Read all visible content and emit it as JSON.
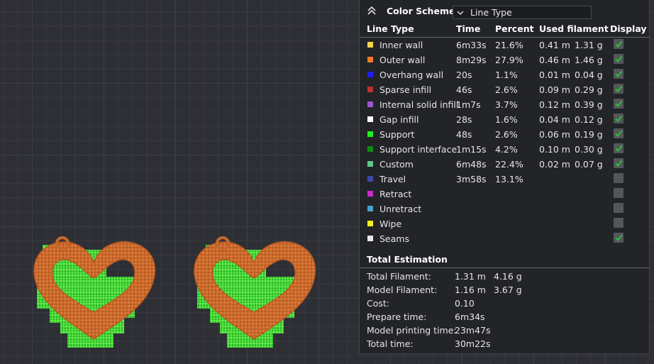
{
  "panel": {
    "title": "Color Scheme",
    "scheme_select": "Line Type",
    "headers": {
      "line_type": "Line Type",
      "time": "Time",
      "percent": "Percent",
      "used_filament": "Used filament",
      "display": "Display"
    },
    "rows": [
      {
        "name": "Inner wall",
        "color": "#f5d54b",
        "time": "6m33s",
        "percent": "21.6%",
        "meters": "0.41 m",
        "grams": "1.31 g",
        "display": true
      },
      {
        "name": "Outer wall",
        "color": "#f07a2c",
        "time": "8m29s",
        "percent": "27.9%",
        "meters": "0.46 m",
        "grams": "1.46 g",
        "display": true
      },
      {
        "name": "Overhang wall",
        "color": "#1f1ff0",
        "time": "20s",
        "percent": "1.1%",
        "meters": "0.01 m",
        "grams": "0.04 g",
        "display": true
      },
      {
        "name": "Sparse infill",
        "color": "#b83333",
        "time": "46s",
        "percent": "2.6%",
        "meters": "0.09 m",
        "grams": "0.29 g",
        "display": true
      },
      {
        "name": "Internal solid infill",
        "color": "#9a5ad0",
        "time": "1m7s",
        "percent": "3.7%",
        "meters": "0.12 m",
        "grams": "0.39 g",
        "display": true
      },
      {
        "name": "Gap infill",
        "color": "#ffffff",
        "time": "28s",
        "percent": "1.6%",
        "meters": "0.04 m",
        "grams": "0.12 g",
        "display": true
      },
      {
        "name": "Support",
        "color": "#22ee22",
        "time": "48s",
        "percent": "2.6%",
        "meters": "0.06 m",
        "grams": "0.19 g",
        "display": true
      },
      {
        "name": "Support interface",
        "color": "#128a12",
        "time": "1m15s",
        "percent": "4.2%",
        "meters": "0.10 m",
        "grams": "0.30 g",
        "display": true
      },
      {
        "name": "Custom",
        "color": "#5ec88e",
        "time": "6m48s",
        "percent": "22.4%",
        "meters": "0.02 m",
        "grams": "0.07 g",
        "display": true
      },
      {
        "name": "Travel",
        "color": "#3c4aa6",
        "time": "3m58s",
        "percent": "13.1%",
        "meters": "",
        "grams": "",
        "display": false
      },
      {
        "name": "Retract",
        "color": "#cc2acc",
        "time": "",
        "percent": "",
        "meters": "",
        "grams": "",
        "display": false
      },
      {
        "name": "Unretract",
        "color": "#46a0d0",
        "time": "",
        "percent": "",
        "meters": "",
        "grams": "",
        "display": false
      },
      {
        "name": "Wipe",
        "color": "#f0f020",
        "time": "",
        "percent": "",
        "meters": "",
        "grams": "",
        "display": false
      },
      {
        "name": "Seams",
        "color": "#e8e8e8",
        "time": "",
        "percent": "",
        "meters": "",
        "grams": "",
        "display": true
      }
    ],
    "total_title": "Total Estimation",
    "estimation": [
      {
        "label": "Total Filament:",
        "v1": "1.31 m",
        "v2": "4.16 g"
      },
      {
        "label": "Model Filament:",
        "v1": "1.16 m",
        "v2": "3.67 g"
      },
      {
        "label": "Cost:",
        "v1": "0.10",
        "v2": ""
      },
      {
        "label": "Prepare time:",
        "v1": "6m34s",
        "v2": ""
      },
      {
        "label": "Model printing time:",
        "v1": "23m47s",
        "v2": ""
      },
      {
        "label": "Total time:",
        "v1": "30m22s",
        "v2": ""
      }
    ]
  },
  "colors": {
    "model_orange": "#d0702e",
    "support_green": "#2fd82f",
    "checkbox_green": "#2bbf3a",
    "background": "#2e2f35"
  },
  "icons": {
    "collapse": "double-chevron-up-icon",
    "dropdown": "chevron-down-icon",
    "check": "check-icon"
  }
}
